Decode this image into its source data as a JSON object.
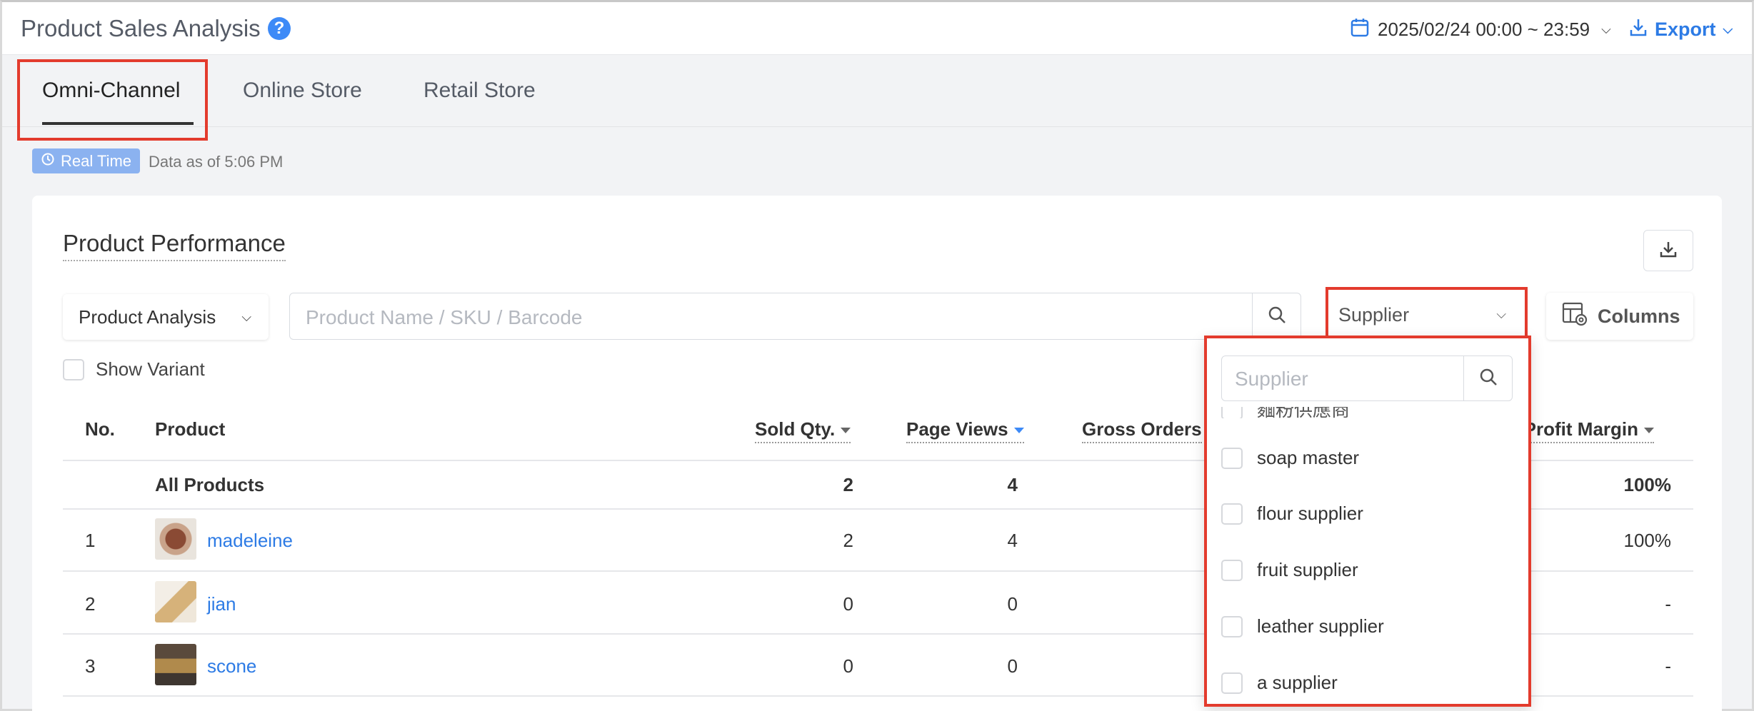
{
  "header": {
    "title": "Product Sales Analysis",
    "help_symbol": "?",
    "date_range": "2025/02/24 00:00 ~ 23:59",
    "export_label": "Export"
  },
  "tabs": [
    {
      "label": "Omni-Channel",
      "active": true
    },
    {
      "label": "Online Store",
      "active": false
    },
    {
      "label": "Retail Store",
      "active": false
    }
  ],
  "realtime": {
    "badge": "Real Time",
    "data_as_of": "Data as of 5:06 PM"
  },
  "performance": {
    "title": "Product Performance",
    "analysis_select": "Product Analysis",
    "search_placeholder": "Product Name / SKU / Barcode",
    "supplier_select": "Supplier",
    "columns_label": "Columns",
    "show_variant_label": "Show Variant"
  },
  "table": {
    "headers": {
      "no": "No.",
      "product": "Product",
      "sold_qty": "Sold Qty.",
      "page_views": "Page Views",
      "gross_orders": "Gross Orders",
      "profit_margin": "s Profit Margin"
    },
    "summary": {
      "label": "All Products",
      "sold_qty": "2",
      "page_views": "4",
      "profit_margin": "100%"
    },
    "rows": [
      {
        "no": "1",
        "name": "madeleine",
        "sold_qty": "2",
        "page_views": "4",
        "profit_margin": "100%"
      },
      {
        "no": "2",
        "name": "jian",
        "sold_qty": "0",
        "page_views": "0",
        "profit_margin": "-"
      },
      {
        "no": "3",
        "name": "scone",
        "sold_qty": "0",
        "page_views": "0",
        "profit_margin": "-"
      }
    ]
  },
  "supplier_dropdown": {
    "search_placeholder": "Supplier",
    "partial_item": "麵粉供應商",
    "items": [
      "soap master",
      "flour supplier",
      "fruit supplier",
      "leather supplier",
      "a supplier"
    ]
  },
  "colors": {
    "accent": "#2d7be5",
    "highlight": "#e33b2d",
    "badge": "#8bb2f0"
  }
}
